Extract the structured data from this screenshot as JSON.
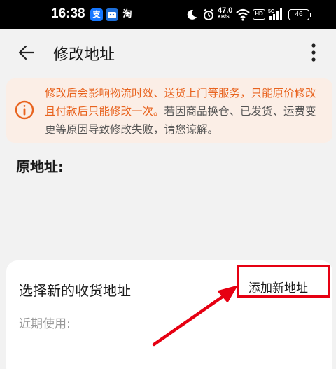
{
  "status_bar": {
    "time": "16:38",
    "apps": [
      "支",
      "淘"
    ],
    "net_speed_value": "47.0",
    "net_speed_unit": "KB/S",
    "hd_label": "HD",
    "signal_label": "5G",
    "battery": "46"
  },
  "header": {
    "title": "修改地址",
    "back_icon": "arrow-left-icon",
    "more_icon": "more-vertical-icon"
  },
  "notice": {
    "icon": "info-circle-icon",
    "text_orange": "修改后会影响物流时效、送货上门等服务，只能原价修改且付款后只能修改一次。",
    "text_grey": "若因商品换仓、已发货、运费变更等原因导致修改失败，请您谅解。",
    "color_orange": "#e8631e"
  },
  "original_address": {
    "label": "原地址:"
  },
  "select_card": {
    "title": "选择新的收货地址",
    "add_button": "添加新地址",
    "recent_label": "近期使用:"
  },
  "annotation": {
    "color": "#e60012"
  }
}
